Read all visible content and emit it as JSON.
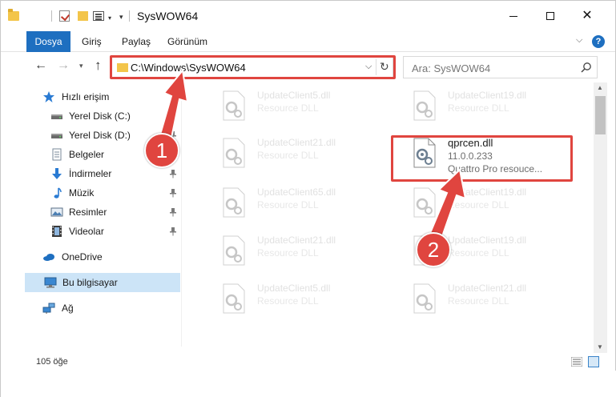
{
  "window": {
    "title": "SysWOW64",
    "icons": [
      "folder-icon",
      "checkmark-icon",
      "folder-icon",
      "properties-icon"
    ]
  },
  "ribbon": {
    "tabs": [
      "Dosya",
      "Giriş",
      "Paylaş",
      "Görünüm"
    ],
    "active_tab": "Dosya",
    "help_label": "?"
  },
  "nav": {
    "path": "C:\\Windows\\SysWOW64",
    "search_placeholder": "Ara: SysWOW64"
  },
  "sidebar": {
    "items": [
      {
        "label": "Hızlı erişim",
        "icon": "star-icon",
        "pinned": false
      },
      {
        "label": "Yerel Disk (C:)",
        "icon": "drive-icon",
        "pinned": true
      },
      {
        "label": "Yerel Disk (D:)",
        "icon": "drive-icon",
        "pinned": true
      },
      {
        "label": "Belgeler",
        "icon": "document-icon",
        "pinned": true
      },
      {
        "label": "İndirmeler",
        "icon": "download-icon",
        "pinned": true
      },
      {
        "label": "Müzik",
        "icon": "music-icon",
        "pinned": true
      },
      {
        "label": "Resimler",
        "icon": "pictures-icon",
        "pinned": true
      },
      {
        "label": "Videolar",
        "icon": "video-icon",
        "pinned": true
      },
      {
        "label": "OneDrive",
        "icon": "cloud-icon",
        "pinned": false
      },
      {
        "label": "Bu bilgisayar",
        "icon": "computer-icon",
        "pinned": false,
        "selected": true
      },
      {
        "label": "Ağ",
        "icon": "network-icon",
        "pinned": false
      }
    ]
  },
  "files": [
    {
      "name": "UpdateClient5.dll",
      "desc": "Resource DLL"
    },
    {
      "name": "UpdateClient19.dll",
      "desc": "Resource DLL"
    },
    {
      "name": "UpdateClient21.dll",
      "desc": "Resource DLL"
    },
    {
      "name": "qprcen.dll",
      "version": "11.0.0.233",
      "desc": "Quattro Pro resouce..."
    },
    {
      "name": "UpdateClient65.dll",
      "desc": "Resource DLL"
    },
    {
      "name": "UpdateClient19.dll",
      "desc": "Resource DLL"
    },
    {
      "name": "UpdateClient21.dll",
      "desc": "Resource DLL"
    },
    {
      "name": "UpdateClient19.dll",
      "desc": "Resource DLL"
    },
    {
      "name": "UpdateClient5.dll",
      "desc": "Resource DLL"
    },
    {
      "name": "UpdateClient21.dll",
      "desc": "Resource DLL"
    }
  ],
  "status": {
    "item_count": "105 öğe"
  },
  "callouts": {
    "step1": "1",
    "step2": "2",
    "color": "#e0453f"
  },
  "colors": {
    "accent": "#1e6fc0",
    "highlight": "#e0453f",
    "selection": "#cce4f7"
  }
}
